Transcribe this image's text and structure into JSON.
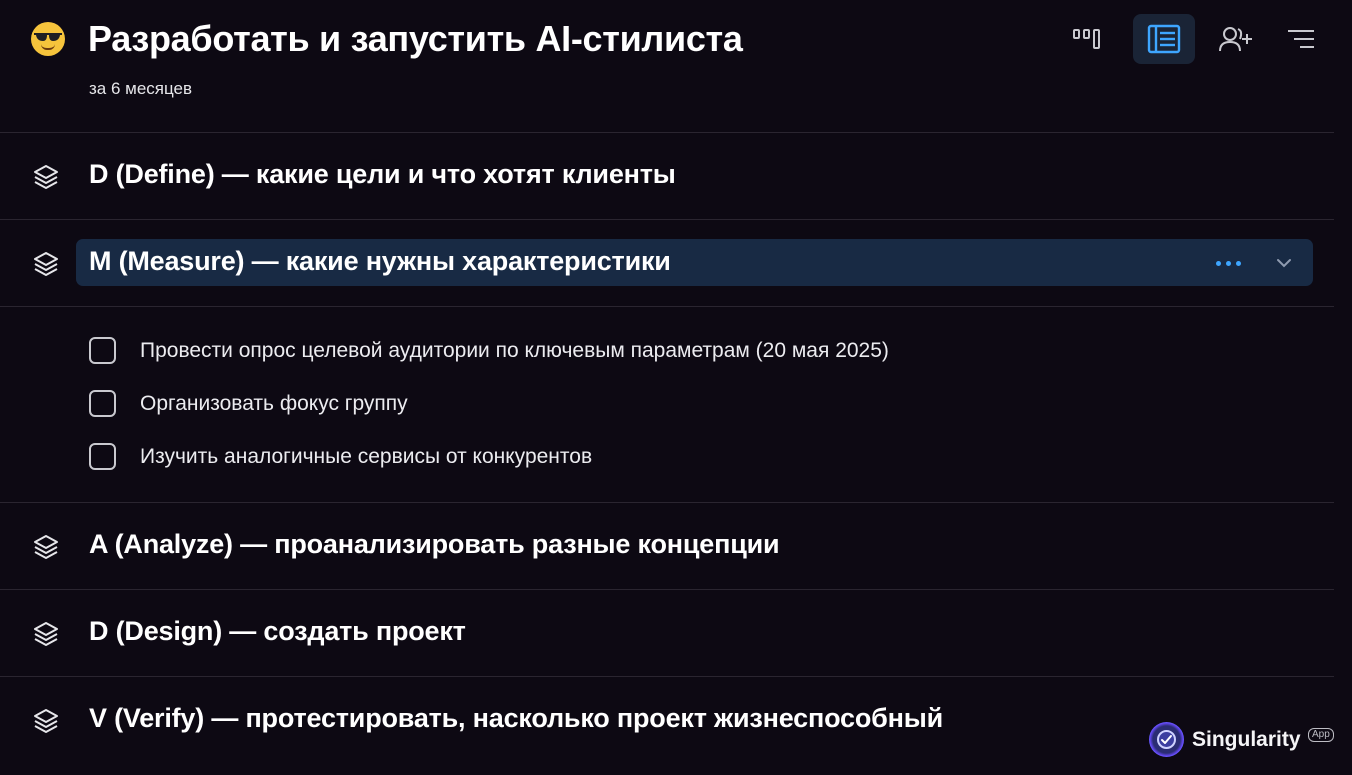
{
  "header": {
    "emoji": "smiling-face-with-sunglasses",
    "title": "Разработать и запустить AI-стилиста",
    "subtitle": "за 6 месяцев"
  },
  "toolbar": {
    "buttons": [
      {
        "name": "board-view",
        "icon": "kanban-icon",
        "active": false
      },
      {
        "name": "list-view",
        "icon": "list-icon",
        "active": true
      },
      {
        "name": "share",
        "icon": "add-user-icon",
        "active": false
      },
      {
        "name": "sort",
        "icon": "sort-icon",
        "active": false
      }
    ],
    "accent": "#3ea6ff"
  },
  "sections": [
    {
      "title": "D (Define) — какие цели и что хотят клиенты",
      "expanded": false
    },
    {
      "title": "M (Measure) — какие нужны характеристики",
      "expanded": true,
      "tasks": [
        {
          "label": "Провести опрос целевой аудитории по ключевым параметрам (20 мая 2025)",
          "checked": false
        },
        {
          "label": "Организовать фокус группу",
          "checked": false
        },
        {
          "label": "Изучить аналогичные сервисы от конкурентов",
          "checked": false
        }
      ]
    },
    {
      "title": "A (Analyze) — проанализировать разные концепции",
      "expanded": false
    },
    {
      "title": "D (Design) — создать проект",
      "expanded": false
    },
    {
      "title": "V (Verify) — протестировать, насколько проект жизнеспособный",
      "expanded": false
    }
  ],
  "brand": {
    "name": "Singularity",
    "tag": "App"
  },
  "colors": {
    "background": "#0d0913",
    "selected_row": "#182a44",
    "divider": "#2a2530"
  }
}
